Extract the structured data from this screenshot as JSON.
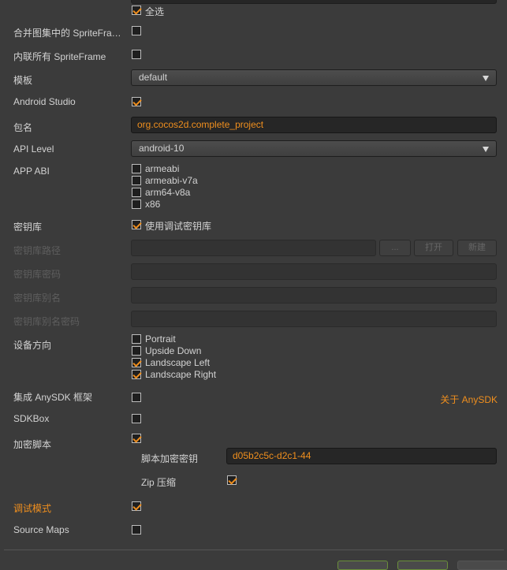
{
  "select_all": {
    "label": "全选",
    "checked": true
  },
  "merge_spriteframes": {
    "label": "合并图集中的 SpriteFra…",
    "checked": false
  },
  "inline_spriteframe": {
    "label": "内联所有 SpriteFrame",
    "checked": false
  },
  "template": {
    "label": "模板",
    "value": "default"
  },
  "android_studio": {
    "label": "Android Studio",
    "checked": true
  },
  "package_name": {
    "label": "包名",
    "value": "org.cocos2d.complete_project"
  },
  "api_level": {
    "label": "API Level",
    "value": "android-10"
  },
  "app_abi": {
    "label": "APP ABI",
    "options": [
      {
        "label": "armeabi",
        "checked": false
      },
      {
        "label": "armeabi-v7a",
        "checked": false
      },
      {
        "label": "arm64-v8a",
        "checked": false
      },
      {
        "label": "x86",
        "checked": false
      }
    ]
  },
  "keystore": {
    "label": "密钥库",
    "use_debug_label": "使用调试密钥库",
    "use_debug_checked": true
  },
  "keystore_path": {
    "label": "密钥库路径",
    "browse_label": "...",
    "open_label": "打开",
    "new_label": "新建"
  },
  "keystore_password": {
    "label": "密钥库密码"
  },
  "keystore_alias": {
    "label": "密钥库别名"
  },
  "keystore_alias_password": {
    "label": "密钥库别名密码"
  },
  "orientation": {
    "label": "设备方向",
    "options": [
      {
        "label": "Portrait",
        "checked": false
      },
      {
        "label": "Upside Down",
        "checked": false
      },
      {
        "label": "Landscape Left",
        "checked": true
      },
      {
        "label": "Landscape Right",
        "checked": true
      }
    ]
  },
  "anysdk": {
    "label": "集成 AnySDK 框架",
    "checked": false,
    "link": "关于 AnySDK"
  },
  "sdkbox": {
    "label": "SDKBox",
    "checked": false
  },
  "encrypt_script": {
    "label": "加密脚本",
    "checked": true
  },
  "encrypt_key": {
    "label": "脚本加密密钥",
    "value": "d05b2c5c-d2c1-44"
  },
  "zip": {
    "label": "Zip 压缩",
    "checked": true
  },
  "debug_mode": {
    "label": "调试模式",
    "checked": true
  },
  "source_maps": {
    "label": "Source Maps",
    "checked": false
  }
}
